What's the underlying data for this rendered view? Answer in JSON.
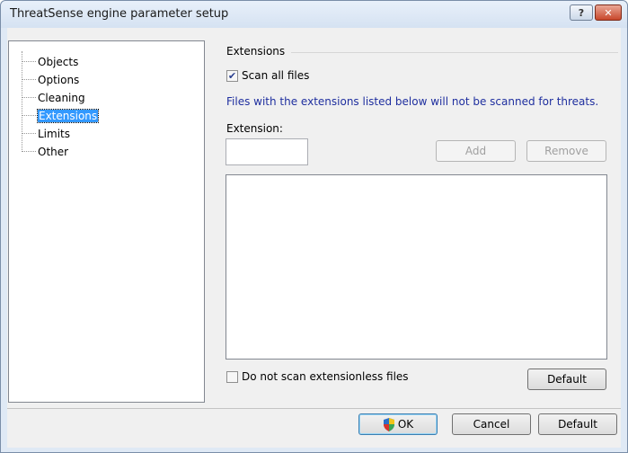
{
  "window": {
    "title": "ThreatSense engine parameter setup",
    "help_label": "?",
    "close_label": "✕"
  },
  "tree": {
    "items": [
      {
        "label": "Objects"
      },
      {
        "label": "Options"
      },
      {
        "label": "Cleaning"
      },
      {
        "label": "Extensions",
        "selected": true
      },
      {
        "label": "Limits"
      },
      {
        "label": "Other"
      }
    ]
  },
  "extensions": {
    "group_title": "Extensions",
    "scan_all_label": "Scan all files",
    "scan_all_checked": true,
    "check_glyph": "✔",
    "info_text": "Files with the extensions listed below will not be scanned for threats.",
    "extension_label": "Extension:",
    "extension_value": "",
    "add_label": "Add",
    "remove_label": "Remove",
    "list_items": [],
    "no_extensionless_label": "Do not scan extensionless files",
    "no_extensionless_checked": false,
    "default_label": "Default"
  },
  "footer": {
    "ok_label": "OK",
    "cancel_label": "Cancel",
    "default_label": "Default"
  },
  "colors": {
    "selection": "#3399ff",
    "info_text": "#1f2f9f"
  }
}
